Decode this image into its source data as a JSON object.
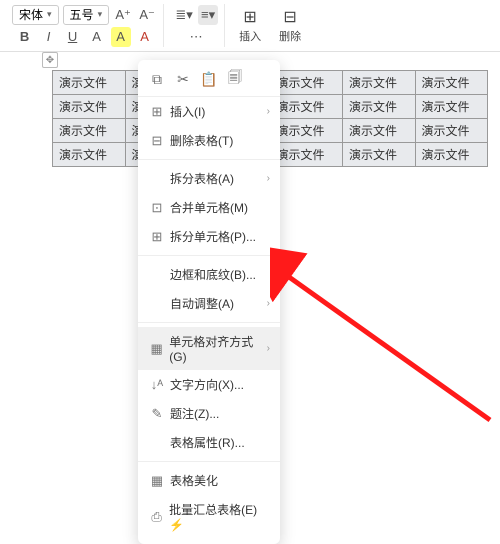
{
  "toolbar": {
    "font_name": "宋体",
    "font_size": "五号",
    "bold": "B",
    "italic": "I",
    "underline": "U",
    "strike": "A",
    "highlight": "A",
    "fontcolor": "A",
    "insert_label": "插入",
    "delete_label": "删除"
  },
  "table": {
    "cell_text": "演示文件",
    "rows": 4,
    "cols": 6
  },
  "context_menu": {
    "top_icons": [
      "copy",
      "cut",
      "paste",
      "paste-special"
    ],
    "items": [
      {
        "icon": "⊞",
        "label": "插入(I)",
        "arrow": true
      },
      {
        "icon": "⊟",
        "label": "删除表格(T)",
        "arrow": false
      },
      {
        "icon": "",
        "label": "拆分表格(A)",
        "arrow": true,
        "sep_before": true
      },
      {
        "icon": "⊡",
        "label": "合并单元格(M)",
        "arrow": false
      },
      {
        "icon": "⊞",
        "label": "拆分单元格(P)...",
        "arrow": false
      },
      {
        "icon": "",
        "label": "边框和底纹(B)...",
        "arrow": false,
        "sep_before": true
      },
      {
        "icon": "",
        "label": "自动调整(A)",
        "arrow": true
      },
      {
        "icon": "▦",
        "label": "单元格对齐方式(G)",
        "arrow": true,
        "sep_before": true,
        "highlight": true
      },
      {
        "icon": "↓ᴬ",
        "label": "文字方向(X)...",
        "arrow": false
      },
      {
        "icon": "✎",
        "label": "题注(Z)...",
        "arrow": false
      },
      {
        "icon": "",
        "label": "表格属性(R)...",
        "arrow": false
      },
      {
        "icon": "▦",
        "label": "表格美化",
        "arrow": false,
        "sep_before": true
      },
      {
        "icon": "⎙",
        "label": "批量汇总表格(E)  ⚡",
        "arrow": false
      }
    ]
  }
}
